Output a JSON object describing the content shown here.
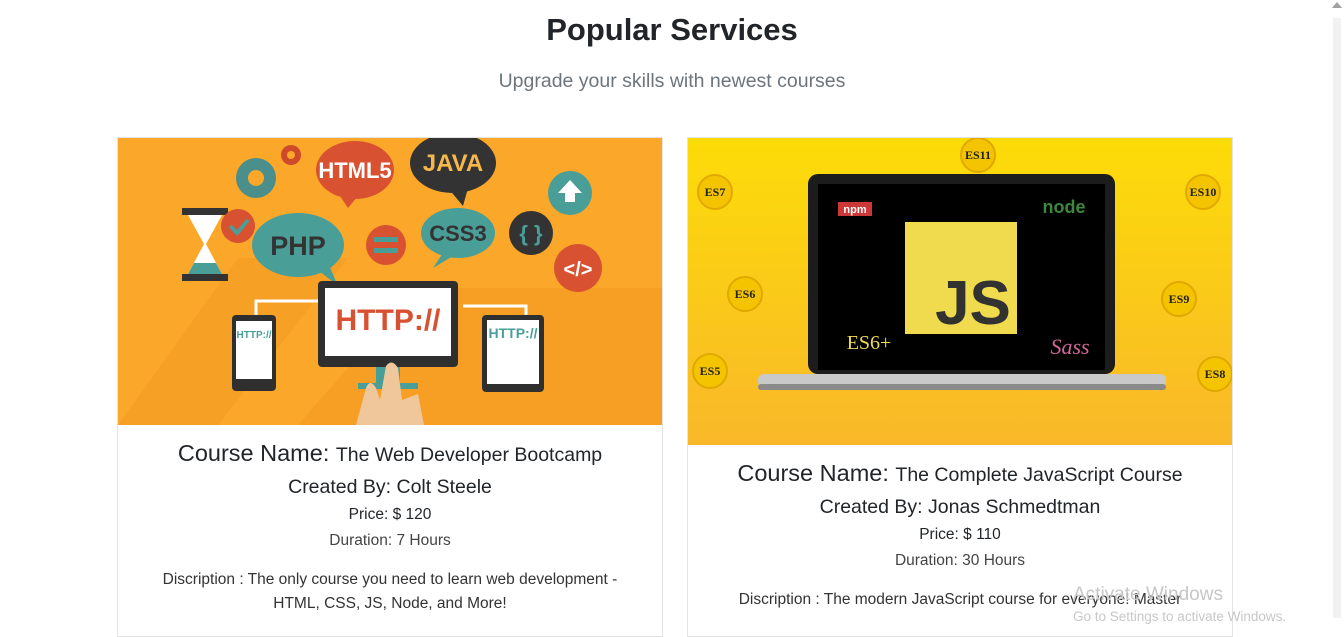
{
  "header": {
    "title": "Popular Services",
    "subtitle": "Upgrade your skills with newest courses"
  },
  "courses": [
    {
      "name_label": "Course Name:",
      "name": "The Web Developer Bootcamp",
      "creator_label": "Created By:",
      "creator": "Colt Steele",
      "price_label": "Price:",
      "price": "$ 120",
      "duration_label": "Duration:",
      "duration": "7 Hours",
      "description": "Discription : The only course you need to learn web development - HTML, CSS, JS, Node, and More!",
      "image": {
        "badges": [
          "HTML5",
          "JAVA",
          "PHP",
          "CSS3",
          "{ }",
          "</>",
          "HTTP://",
          "HTTP://",
          "HTTP://"
        ],
        "bg_color": "#fba72a"
      }
    },
    {
      "name_label": "Course Name:",
      "name": "The Complete JavaScript Course",
      "creator_label": "Created By:",
      "creator": "Jonas Schmedtman",
      "price_label": "Price:",
      "price": "$ 110",
      "duration_label": "Duration:",
      "duration": "30 Hours",
      "description": "Discription : The modern JavaScript course for everyone! Master",
      "image": {
        "badges": [
          "ES11",
          "ES7",
          "ES10",
          "ES6",
          "ES9",
          "ES5",
          "ES8"
        ],
        "screen_labels": [
          "npm",
          "node",
          "JS",
          "ES6+",
          "Sass"
        ],
        "bg_color": "#fbd40a"
      }
    }
  ],
  "watermark": {
    "line1": "Activate Windows",
    "line2": "Go to Settings to activate Windows."
  }
}
